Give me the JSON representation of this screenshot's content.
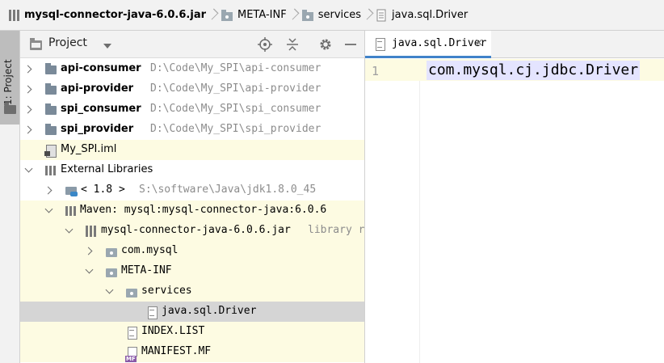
{
  "breadcrumb": {
    "items": [
      {
        "label": "mysql-connector-java-6.0.6.jar",
        "icon": "jar-icon"
      },
      {
        "label": "META-INF",
        "icon": "folder-icon"
      },
      {
        "label": "services",
        "icon": "folder-icon"
      },
      {
        "label": "java.sql.Driver",
        "icon": "text-file-icon"
      }
    ]
  },
  "tool_stripe": {
    "project_tab_label": "1: Project"
  },
  "project_panel": {
    "title": "Project",
    "header_icons": [
      "locate-icon",
      "collapse-all-icon",
      "gear-icon",
      "minimize-icon"
    ]
  },
  "tree": {
    "rows": [
      {
        "label": "api-consumer",
        "path": "D:\\Code\\My_SPI\\api-consumer"
      },
      {
        "label": "api-provider",
        "path": "D:\\Code\\My_SPI\\api-provider"
      },
      {
        "label": "spi_consumer",
        "path": "D:\\Code\\My_SPI\\spi_consumer"
      },
      {
        "label": "spi_provider",
        "path": "D:\\Code\\My_SPI\\spi_provider"
      },
      {
        "label": "My_SPI.iml"
      },
      {
        "label": "External Libraries"
      },
      {
        "label": "< 1.8 >",
        "path": "S:\\software\\Java\\jdk1.8.0_45"
      },
      {
        "label": "Maven: mysql:mysql-connector-java:6.0.6"
      },
      {
        "label": "mysql-connector-java-6.0.6.jar",
        "path": "library r"
      },
      {
        "label": "com.mysql"
      },
      {
        "label": "META-INF"
      },
      {
        "label": "services"
      },
      {
        "label": "java.sql.Driver"
      },
      {
        "label": "INDEX.LIST"
      },
      {
        "label": "MANIFEST.MF"
      }
    ]
  },
  "editor": {
    "tab_label": "java.sql.Driver",
    "tab_close": "×",
    "line_number": "1",
    "code": "com.mysql.cj.jdbc.Driver"
  },
  "colors": {
    "accent": "#4083c9",
    "highlight_row": "#fdfbe2",
    "selected_row": "#d5d5d5",
    "code_selection": "#e4e4ff"
  }
}
